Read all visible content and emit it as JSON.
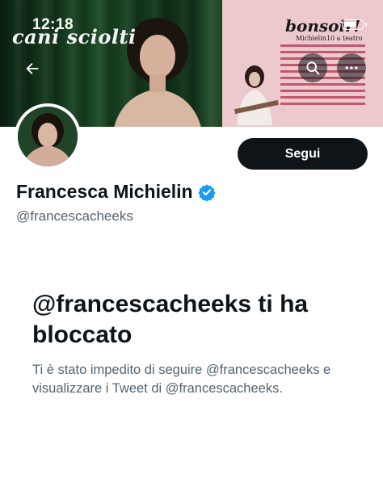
{
  "status_bar": {
    "time": "12:18"
  },
  "banner": {
    "brand_left": "cani sciolti",
    "brand_right": "bonsoir!",
    "brand_sub": "Michielin10 a teatro"
  },
  "header_actions": {
    "back_icon": "arrow-left-icon",
    "search_icon": "search-icon",
    "more_icon": "more-horizontal-icon"
  },
  "profile": {
    "display_name": "Francesca Michielin",
    "handle": "@francescacheeks",
    "follow_label": "Segui",
    "verified": true
  },
  "blocked": {
    "title": "@francescacheeks ti ha bloccato",
    "description": "Ti è stato impedito di seguire @francescacheeks e visualizzare i Tweet di @francescacheeks."
  },
  "colors": {
    "accent_blue": "#1d9bf0",
    "text_primary": "#0f1419",
    "text_secondary": "#536471",
    "button_dark": "#0f1419"
  }
}
